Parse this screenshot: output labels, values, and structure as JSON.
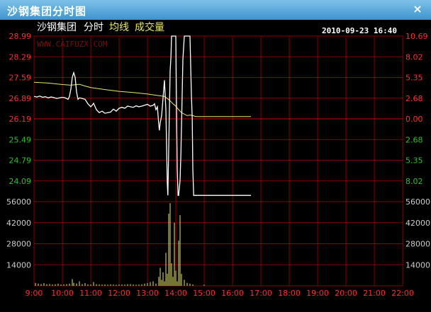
{
  "window": {
    "title": "沙钢集团分时图",
    "close_glyph": "×"
  },
  "header": {
    "stock_name": "沙钢集团",
    "chart_label": "分时",
    "avg_label": "均线",
    "volume_label": "成交量",
    "datetime": "2010-09-23 16:40",
    "watermark": "WWW.CAIFUZX.COM"
  },
  "colors": {
    "grid": "#8b0000",
    "price_line": "#ffffff",
    "avg_line": "#e8e86a",
    "volume_bar": "#e8e86a",
    "up_text": "#ff3030",
    "down_text": "#30c030",
    "axis_text": "#cccccc",
    "header_text": "#ffffff",
    "accent_text": "#e8e86a"
  },
  "chart_data": {
    "type": "line",
    "title": "",
    "price_axis": {
      "ticks": [
        {
          "value": 28.99,
          "label": "28.99",
          "pct": "10.69",
          "side": "up"
        },
        {
          "value": 28.29,
          "label": "28.29",
          "pct": "8.02",
          "side": "up"
        },
        {
          "value": 27.59,
          "label": "27.59",
          "pct": "5.35",
          "side": "up"
        },
        {
          "value": 26.89,
          "label": "26.89",
          "pct": "2.68",
          "side": "up"
        },
        {
          "value": 26.19,
          "label": "26.19",
          "pct": "0.00",
          "side": "flat"
        },
        {
          "value": 25.49,
          "label": "25.49",
          "pct": "2.68",
          "side": "down"
        },
        {
          "value": 24.79,
          "label": "24.79",
          "pct": "5.35",
          "side": "down"
        },
        {
          "value": 24.09,
          "label": "24.09",
          "pct": "8.02",
          "side": "down"
        }
      ],
      "min": 23.39,
      "max": 28.99
    },
    "volume_axis": {
      "ticks": [
        {
          "value": 56000,
          "label": "56000"
        },
        {
          "value": 42000,
          "label": "42000"
        },
        {
          "value": 28000,
          "label": "28000"
        },
        {
          "value": 14000,
          "label": "14000"
        }
      ],
      "max": 56000
    },
    "time_axis": {
      "labels": [
        "9:00",
        "10:00",
        "11:00",
        "12:00",
        "13:00",
        "14:00",
        "15:00",
        "16:00",
        "17:00",
        "18:00",
        "19:00",
        "20:00",
        "21:00",
        "22:00"
      ],
      "start": 9.0,
      "end": 22.0
    },
    "price_series": {
      "name": "",
      "points": [
        [
          9.0,
          26.95
        ],
        [
          9.1,
          26.93
        ],
        [
          9.2,
          26.96
        ],
        [
          9.3,
          26.92
        ],
        [
          9.4,
          26.94
        ],
        [
          9.5,
          26.9
        ],
        [
          9.6,
          26.93
        ],
        [
          9.7,
          26.91
        ],
        [
          9.8,
          26.88
        ],
        [
          9.9,
          26.9
        ],
        [
          10.0,
          26.92
        ],
        [
          10.1,
          26.9
        ],
        [
          10.2,
          26.85
        ],
        [
          10.25,
          26.95
        ],
        [
          10.3,
          27.2
        ],
        [
          10.35,
          27.6
        ],
        [
          10.4,
          27.75
        ],
        [
          10.45,
          27.6
        ],
        [
          10.5,
          27.1
        ],
        [
          10.55,
          26.85
        ],
        [
          10.6,
          26.9
        ],
        [
          10.7,
          26.88
        ],
        [
          10.8,
          26.85
        ],
        [
          10.9,
          26.7
        ],
        [
          11.0,
          26.6
        ],
        [
          11.05,
          26.65
        ],
        [
          11.1,
          26.72
        ],
        [
          11.2,
          26.5
        ],
        [
          11.3,
          26.4
        ],
        [
          11.4,
          26.45
        ],
        [
          11.5,
          26.38
        ],
        [
          11.6,
          26.4
        ],
        [
          11.7,
          26.42
        ],
        [
          11.8,
          26.52
        ],
        [
          11.9,
          26.45
        ],
        [
          12.0,
          26.55
        ],
        [
          12.1,
          26.58
        ],
        [
          12.2,
          26.55
        ],
        [
          12.3,
          26.62
        ],
        [
          12.4,
          26.6
        ],
        [
          12.5,
          26.58
        ],
        [
          12.6,
          26.63
        ],
        [
          12.7,
          26.6
        ],
        [
          12.8,
          26.62
        ],
        [
          12.9,
          26.65
        ],
        [
          13.0,
          26.68
        ],
        [
          13.1,
          26.62
        ],
        [
          13.2,
          26.65
        ],
        [
          13.25,
          26.7
        ],
        [
          13.3,
          26.5
        ],
        [
          13.35,
          26.6
        ],
        [
          13.4,
          26.0
        ],
        [
          13.42,
          25.8
        ],
        [
          13.45,
          26.05
        ],
        [
          13.5,
          26.3
        ],
        [
          13.55,
          26.9
        ],
        [
          13.6,
          27.5
        ],
        [
          13.65,
          26.5
        ],
        [
          13.7,
          24.0
        ],
        [
          13.72,
          23.6
        ],
        [
          13.75,
          25.2
        ],
        [
          13.8,
          27.8
        ],
        [
          13.83,
          28.3
        ],
        [
          13.85,
          28.99
        ],
        [
          13.9,
          28.99
        ],
        [
          13.95,
          28.99
        ],
        [
          14.0,
          28.99
        ],
        [
          14.02,
          27.0
        ],
        [
          14.05,
          24.5
        ],
        [
          14.08,
          23.6
        ],
        [
          14.1,
          23.6
        ],
        [
          14.15,
          24.1
        ],
        [
          14.18,
          25.0
        ],
        [
          14.22,
          26.8
        ],
        [
          14.25,
          28.2
        ],
        [
          14.3,
          28.99
        ],
        [
          14.4,
          28.99
        ],
        [
          14.5,
          28.99
        ],
        [
          14.55,
          27.0
        ],
        [
          14.58,
          26.2
        ],
        [
          14.6,
          24.5
        ],
        [
          14.63,
          23.6
        ],
        [
          14.7,
          23.6
        ],
        [
          15.0,
          23.6
        ],
        [
          15.5,
          23.6
        ],
        [
          16.0,
          23.6
        ],
        [
          16.5,
          23.6
        ],
        [
          16.65,
          23.6
        ]
      ]
    },
    "avg_series": {
      "name": "",
      "points": [
        [
          9.0,
          27.43
        ],
        [
          9.5,
          27.4
        ],
        [
          10.0,
          27.35
        ],
        [
          10.3,
          27.33
        ],
        [
          10.6,
          27.36
        ],
        [
          10.8,
          27.3
        ],
        [
          11.0,
          27.25
        ],
        [
          11.5,
          27.18
        ],
        [
          12.0,
          27.12
        ],
        [
          12.5,
          27.08
        ],
        [
          13.0,
          27.03
        ],
        [
          13.3,
          26.99
        ],
        [
          13.5,
          26.96
        ],
        [
          13.6,
          26.95
        ],
        [
          13.7,
          26.88
        ],
        [
          13.8,
          26.8
        ],
        [
          13.9,
          26.7
        ],
        [
          14.0,
          26.62
        ],
        [
          14.1,
          26.5
        ],
        [
          14.2,
          26.4
        ],
        [
          14.3,
          26.35
        ],
        [
          14.4,
          26.3
        ],
        [
          14.5,
          26.32
        ],
        [
          14.6,
          26.3
        ],
        [
          14.7,
          26.27
        ],
        [
          15.0,
          26.27
        ],
        [
          16.0,
          26.27
        ],
        [
          16.65,
          26.27
        ]
      ]
    },
    "volume_series": {
      "name": "",
      "bars": [
        [
          9.05,
          2000
        ],
        [
          9.15,
          1500
        ],
        [
          9.25,
          1200
        ],
        [
          9.35,
          1800
        ],
        [
          9.45,
          1000
        ],
        [
          9.55,
          1300
        ],
        [
          9.65,
          900
        ],
        [
          9.75,
          1100
        ],
        [
          9.85,
          1400
        ],
        [
          9.95,
          800
        ],
        [
          10.05,
          1000
        ],
        [
          10.15,
          1200
        ],
        [
          10.25,
          1500
        ],
        [
          10.35,
          4500
        ],
        [
          10.4,
          2000
        ],
        [
          10.5,
          1600
        ],
        [
          10.6,
          3000
        ],
        [
          10.7,
          1200
        ],
        [
          10.8,
          1800
        ],
        [
          10.9,
          1000
        ],
        [
          11.0,
          900
        ],
        [
          11.1,
          2500
        ],
        [
          11.2,
          1100
        ],
        [
          11.3,
          1000
        ],
        [
          11.4,
          800
        ],
        [
          11.5,
          900
        ],
        [
          11.6,
          700
        ],
        [
          11.7,
          1000
        ],
        [
          11.8,
          800
        ],
        [
          11.9,
          700
        ],
        [
          12.0,
          1000
        ],
        [
          12.1,
          900
        ],
        [
          12.2,
          800
        ],
        [
          12.3,
          1100
        ],
        [
          12.4,
          1200
        ],
        [
          12.5,
          900
        ],
        [
          12.6,
          700
        ],
        [
          12.7,
          800
        ],
        [
          12.8,
          1000
        ],
        [
          12.9,
          1500
        ],
        [
          13.0,
          1800
        ],
        [
          13.1,
          2500
        ],
        [
          13.2,
          3000
        ],
        [
          13.3,
          1500
        ],
        [
          13.4,
          6000
        ],
        [
          13.45,
          12000
        ],
        [
          13.5,
          4000
        ],
        [
          13.55,
          9000
        ],
        [
          13.6,
          3000
        ],
        [
          13.65,
          22000
        ],
        [
          13.7,
          8000
        ],
        [
          13.75,
          48000
        ],
        [
          13.8,
          55000
        ],
        [
          13.85,
          15000
        ],
        [
          13.9,
          6000
        ],
        [
          13.95,
          42000
        ],
        [
          14.0,
          10000
        ],
        [
          14.05,
          3000
        ],
        [
          14.1,
          30000
        ],
        [
          14.15,
          47000
        ],
        [
          14.2,
          8000
        ],
        [
          14.3,
          4000
        ],
        [
          14.4,
          2000
        ],
        [
          14.5,
          1500
        ],
        [
          14.6,
          900
        ],
        [
          15.0,
          700
        ]
      ]
    }
  }
}
